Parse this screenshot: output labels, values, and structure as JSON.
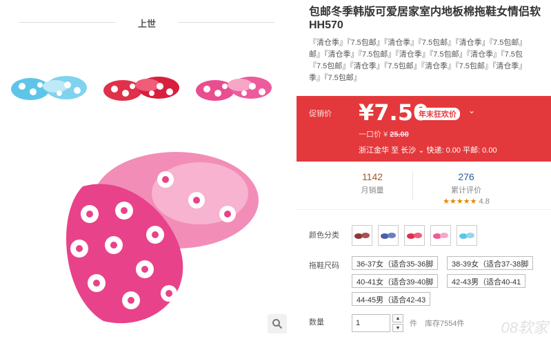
{
  "section": {
    "title": "上世"
  },
  "product": {
    "title": "包邮冬季韩版可爱居家室内地板棉拖鞋女情侣软",
    "subtitle": "HH570",
    "tags": [
      "『清仓季』『7.5包邮』『清仓季』『7.5包邮』『清仓季』『7.5包邮』",
      "邮』『清仓季』『7.5包邮』『清仓季』『7.5包邮』『清仓季』『7.5包",
      "『7.5包邮』『清仓季』『7.5包邮』『清仓季』『7.5包邮』『清仓季』",
      "季』『7.5包邮』"
    ]
  },
  "promo": {
    "label": "促销价",
    "price": "¥7.50",
    "badge": "年末狂欢价",
    "orig_label": "一口价 ¥",
    "orig_price": "25.00",
    "ship_from": "浙江金华",
    "ship_to_word": "至",
    "ship_to": "长沙",
    "ship_fee": "快递: 0.00 平邮: 0.00"
  },
  "stats": {
    "sales_value": "1142",
    "sales_label": "月销量",
    "reviews_value": "276",
    "reviews_label": "累计评价",
    "stars": "★★★★★",
    "rating": "4.8"
  },
  "options": {
    "color_label": "颜色分类",
    "size_label": "拖鞋尺码",
    "sizes": [
      "36-37女（适合35-36脚",
      "38-39女（适合37-38脚",
      "40-41女（适合39-40脚",
      "42-43男（适合40-41",
      "44-45男（适合42-43"
    ],
    "qty_label": "数量",
    "qty_value": "1",
    "qty_unit": "件",
    "stock": "库存7554件"
  },
  "watermark": "08软家",
  "colors": {
    "accent": "#e4393c",
    "swatch_brown": "#8b3a3a",
    "swatch_blue": "#4a5fa8",
    "swatch_red": "#e0304a",
    "swatch_pink": "#ec5c9c",
    "swatch_cyan": "#5ec5e8"
  }
}
